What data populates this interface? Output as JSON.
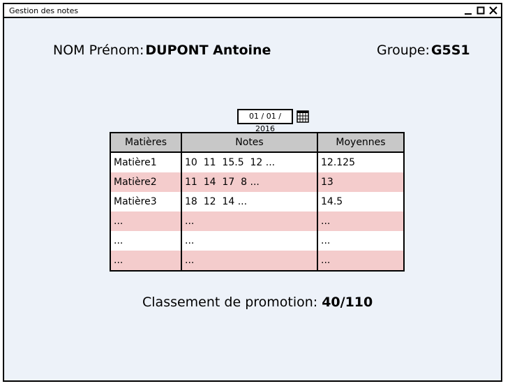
{
  "window": {
    "title": "Gestion des notes",
    "controls": [
      "minimize-icon",
      "maximize-icon",
      "close-icon"
    ]
  },
  "student": {
    "name_label": "NOM Prénom:",
    "name_value": "DUPONT Antoine",
    "group_label": "Groupe:",
    "group_value": "G5S1"
  },
  "date": {
    "value": "01 / 01 / 2016",
    "icon": "calendar-icon"
  },
  "table": {
    "headers": [
      "Matières",
      "Notes",
      "Moyennes"
    ],
    "rows": [
      [
        "Matière1",
        "10  11  15.5  12 ...",
        "12.125"
      ],
      [
        "Matière2",
        "11  14  17  8 ...",
        "13"
      ],
      [
        "Matière3",
        "18  12  14 ...",
        "14.5"
      ],
      [
        "...",
        "...",
        "..."
      ],
      [
        "...",
        "...",
        "..."
      ],
      [
        "...",
        "...",
        "..."
      ]
    ]
  },
  "ranking": {
    "label": "Classement de promotion:",
    "value": "40/110"
  },
  "colors": {
    "background": "#edf2f9",
    "header": "#c8c8c8",
    "row_alt": "#f4cccc"
  }
}
